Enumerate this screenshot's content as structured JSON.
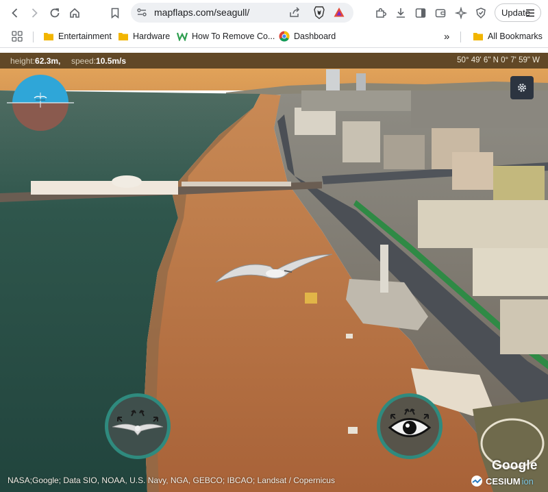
{
  "browser": {
    "url": "mapflaps.com/seagull/",
    "update_label": "Update",
    "bookmarks": [
      {
        "label": "Entertainment",
        "icon": "folder-icon"
      },
      {
        "label": "Hardware",
        "icon": "folder-icon"
      },
      {
        "label": "How To Remove Co...",
        "icon": "w-site-icon"
      },
      {
        "label": "Dashboard",
        "icon": "chrome-favicon"
      }
    ],
    "more_bookmarks_label": "»",
    "all_bookmarks_label": "All Bookmarks"
  },
  "hud": {
    "height_label": "height:",
    "height_value": "62.3m,",
    "speed_label": "speed:",
    "speed_value": "10.5m/s",
    "coordinates": "50° 49' 6\" N 0° 7' 59\" W"
  },
  "controls": {
    "settings_glyph": "⚙",
    "fly_button_icon": "seagull-icon",
    "view_button_icon": "eye-icon"
  },
  "credits": {
    "attribution": "NASA;Google; Data SIO, NOAA, U.S. Navy, NGA, GEBCO; IBCAO; Landsat / Copernicus",
    "google_logo": "Google",
    "cesium_logo": "CESIUM",
    "cesium_suffix": "ion"
  },
  "colors": {
    "sky": "#e2a35a",
    "sea": "#2a4d45",
    "beach": "#b06c3e",
    "hud_bar": "#3c2e18",
    "button_ring": "#2f8a7e",
    "attitude_sky": "#2fa6d8",
    "attitude_ground": "#8a5a4e"
  }
}
